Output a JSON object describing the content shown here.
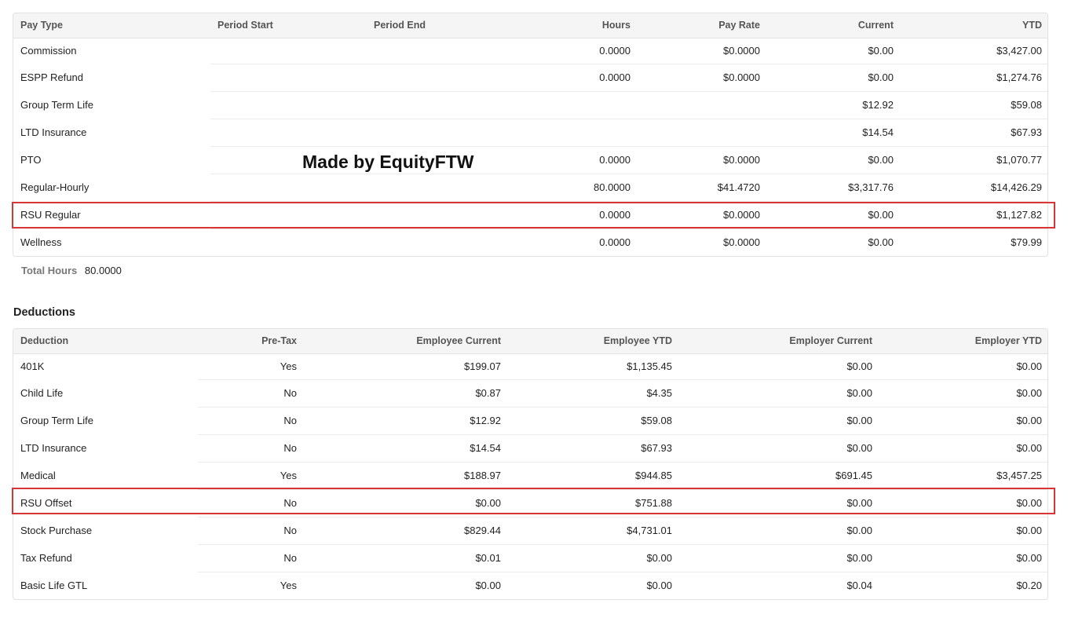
{
  "earnings": {
    "headers": {
      "pay_type": "Pay Type",
      "period_start": "Period Start",
      "period_end": "Period End",
      "hours": "Hours",
      "pay_rate": "Pay Rate",
      "current": "Current",
      "ytd": "YTD"
    },
    "rows": [
      {
        "pay_type": "Commission",
        "period_start": "",
        "period_end": "",
        "hours": "0.0000",
        "pay_rate": "$0.0000",
        "current": "$0.00",
        "ytd": "$3,427.00"
      },
      {
        "pay_type": "ESPP Refund",
        "period_start": "",
        "period_end": "",
        "hours": "0.0000",
        "pay_rate": "$0.0000",
        "current": "$0.00",
        "ytd": "$1,274.76"
      },
      {
        "pay_type": "Group Term Life",
        "period_start": "",
        "period_end": "",
        "hours": "",
        "pay_rate": "",
        "current": "$12.92",
        "ytd": "$59.08"
      },
      {
        "pay_type": "LTD Insurance",
        "period_start": "",
        "period_end": "",
        "hours": "",
        "pay_rate": "",
        "current": "$14.54",
        "ytd": "$67.93"
      },
      {
        "pay_type": "PTO",
        "period_start": "",
        "period_end": "",
        "hours": "0.0000",
        "pay_rate": "$0.0000",
        "current": "$0.00",
        "ytd": "$1,070.77"
      },
      {
        "pay_type": "Regular-Hourly",
        "period_start": "",
        "period_end": "",
        "hours": "80.0000",
        "pay_rate": "$41.4720",
        "current": "$3,317.76",
        "ytd": "$14,426.29"
      },
      {
        "pay_type": "RSU Regular",
        "period_start": "",
        "period_end": "",
        "hours": "0.0000",
        "pay_rate": "$0.0000",
        "current": "$0.00",
        "ytd": "$1,127.82"
      },
      {
        "pay_type": "Wellness",
        "period_start": "",
        "period_end": "",
        "hours": "0.0000",
        "pay_rate": "$0.0000",
        "current": "$0.00",
        "ytd": "$79.99"
      }
    ],
    "total_hours_label": "Total Hours",
    "total_hours_value": "80.0000"
  },
  "watermark": "Made by EquityFTW",
  "deductions": {
    "title": "Deductions",
    "headers": {
      "deduction": "Deduction",
      "pre_tax": "Pre-Tax",
      "employee_current": "Employee Current",
      "employee_ytd": "Employee YTD",
      "employer_current": "Employer Current",
      "employer_ytd": "Employer YTD"
    },
    "rows": [
      {
        "deduction": "401K",
        "pre_tax": "Yes",
        "employee_current": "$199.07",
        "employee_ytd": "$1,135.45",
        "employer_current": "$0.00",
        "employer_ytd": "$0.00"
      },
      {
        "deduction": "Child Life",
        "pre_tax": "No",
        "employee_current": "$0.87",
        "employee_ytd": "$4.35",
        "employer_current": "$0.00",
        "employer_ytd": "$0.00"
      },
      {
        "deduction": "Group Term Life",
        "pre_tax": "No",
        "employee_current": "$12.92",
        "employee_ytd": "$59.08",
        "employer_current": "$0.00",
        "employer_ytd": "$0.00"
      },
      {
        "deduction": "LTD Insurance",
        "pre_tax": "No",
        "employee_current": "$14.54",
        "employee_ytd": "$67.93",
        "employer_current": "$0.00",
        "employer_ytd": "$0.00"
      },
      {
        "deduction": "Medical",
        "pre_tax": "Yes",
        "employee_current": "$188.97",
        "employee_ytd": "$944.85",
        "employer_current": "$691.45",
        "employer_ytd": "$3,457.25"
      },
      {
        "deduction": "RSU Offset",
        "pre_tax": "No",
        "employee_current": "$0.00",
        "employee_ytd": "$751.88",
        "employer_current": "$0.00",
        "employer_ytd": "$0.00"
      },
      {
        "deduction": "Stock Purchase",
        "pre_tax": "No",
        "employee_current": "$829.44",
        "employee_ytd": "$4,731.01",
        "employer_current": "$0.00",
        "employer_ytd": "$0.00"
      },
      {
        "deduction": "Tax Refund",
        "pre_tax": "No",
        "employee_current": "$0.01",
        "employee_ytd": "$0.00",
        "employer_current": "$0.00",
        "employer_ytd": "$0.00"
      },
      {
        "deduction": "Basic Life GTL",
        "pre_tax": "Yes",
        "employee_current": "$0.00",
        "employee_ytd": "$0.00",
        "employer_current": "$0.04",
        "employer_ytd": "$0.20"
      }
    ]
  },
  "colors": {
    "highlight": "#d93535",
    "header_bg": "#f5f5f5",
    "border": "#e2e2e2"
  }
}
